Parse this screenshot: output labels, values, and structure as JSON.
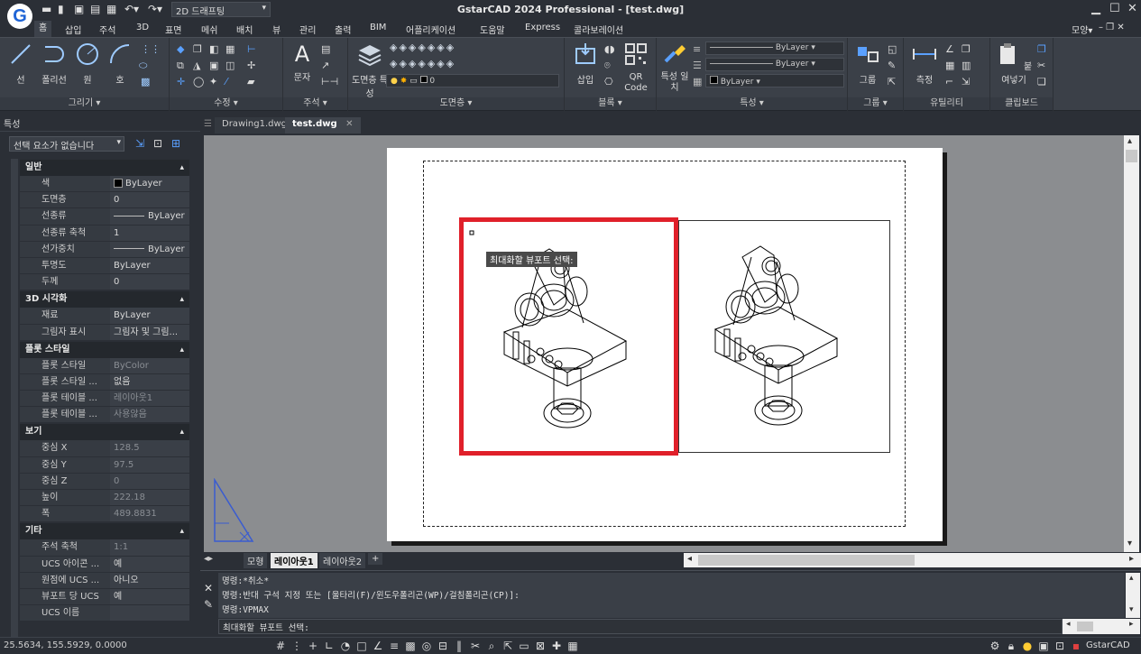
{
  "app": {
    "title": "GstarCAD 2024 Professional - [test.dwg]",
    "workspace": "2D 드래프팅",
    "logo_letter": "G",
    "view_label": "모양",
    "status_brand": "GstarCAD"
  },
  "menu": [
    "홈",
    "삽입",
    "주석",
    "3D",
    "표면",
    "메쉬",
    "배치",
    "뷰",
    "관리",
    "출력",
    "BIM",
    "어플리케이션",
    "도움말",
    "Express",
    "콜라보레이션"
  ],
  "ribbon": {
    "draw": {
      "label": "그리기",
      "line": "선",
      "polyline": "폴리선",
      "circle": "원",
      "arc": "호"
    },
    "modify": {
      "label": "수정"
    },
    "annotation": {
      "label": "주석",
      "text": "문자"
    },
    "layers": {
      "label": "도면층",
      "props": "도면층 특성",
      "current": "0"
    },
    "block": {
      "label": "블록",
      "insert": "삽입",
      "qr": "QR Code"
    },
    "properties": {
      "label": "특성",
      "match": "특성 일치",
      "color": "ByLayer",
      "linetype": "ByLayer",
      "lineweight": "ByLayer"
    },
    "groups": {
      "label": "그룹",
      "group": "그룹"
    },
    "utilities": {
      "label": "유틸리티",
      "measure": "측정"
    },
    "clipboard": {
      "label": "클립보드",
      "paste": "붙여넣기"
    }
  },
  "properties_panel": {
    "title": "특성",
    "selection": "선택 요소가 없습니다",
    "sections": [
      {
        "title": "일반",
        "rows": [
          {
            "k": "색",
            "v": "ByLayer"
          },
          {
            "k": "도면층",
            "v": "0"
          },
          {
            "k": "선종류",
            "v": "ByLayer"
          },
          {
            "k": "선종류 축척",
            "v": "1"
          },
          {
            "k": "선가중치",
            "v": "ByLayer"
          },
          {
            "k": "투명도",
            "v": "ByLayer"
          },
          {
            "k": "두께",
            "v": "0"
          }
        ]
      },
      {
        "title": "3D 시각화",
        "rows": [
          {
            "k": "재료",
            "v": "ByLayer"
          },
          {
            "k": "그림자 표시",
            "v": "그림자 및 그림..."
          }
        ]
      },
      {
        "title": "플롯 스타일",
        "rows": [
          {
            "k": "플롯 스타일",
            "v": "ByColor"
          },
          {
            "k": "플롯 스타일 ...",
            "v": "없음"
          },
          {
            "k": "플롯 테이블 ...",
            "v": "레이아웃1"
          },
          {
            "k": "플롯 테이블 ...",
            "v": "사용않음"
          }
        ]
      },
      {
        "title": "보기",
        "rows": [
          {
            "k": "중심 X",
            "v": "128.5"
          },
          {
            "k": "중심 Y",
            "v": "97.5"
          },
          {
            "k": "중심 Z",
            "v": "0"
          },
          {
            "k": "높이",
            "v": "222.18"
          },
          {
            "k": "폭",
            "v": "489.8831"
          }
        ]
      },
      {
        "title": "기타",
        "rows": [
          {
            "k": "주석 축척",
            "v": "1:1"
          },
          {
            "k": "UCS 아이콘 ...",
            "v": "예"
          },
          {
            "k": "원점에 UCS ...",
            "v": "아니오"
          },
          {
            "k": "뷰포트 당 UCS",
            "v": "예"
          },
          {
            "k": "UCS 이름",
            "v": ""
          }
        ]
      }
    ]
  },
  "doc_tabs": [
    {
      "label": "Drawing1.dwg"
    },
    {
      "label": "test.dwg"
    }
  ],
  "layout_tabs": [
    "모형",
    "레이아웃1",
    "레이아웃2",
    "+"
  ],
  "tooltip": "최대화할 뷰포트 선택:",
  "command": {
    "log": [
      "명령:*취소*",
      "명령:반대 구석 지정 또는 [울타리(F)/윈도우폴리곤(WP)/걸침폴리곤(CP)]:",
      "명령:VPMAX"
    ],
    "prompt": "최대화할 뷰포트 선택:"
  },
  "status": {
    "coords": "25.5634, 155.5929, 0.0000"
  }
}
